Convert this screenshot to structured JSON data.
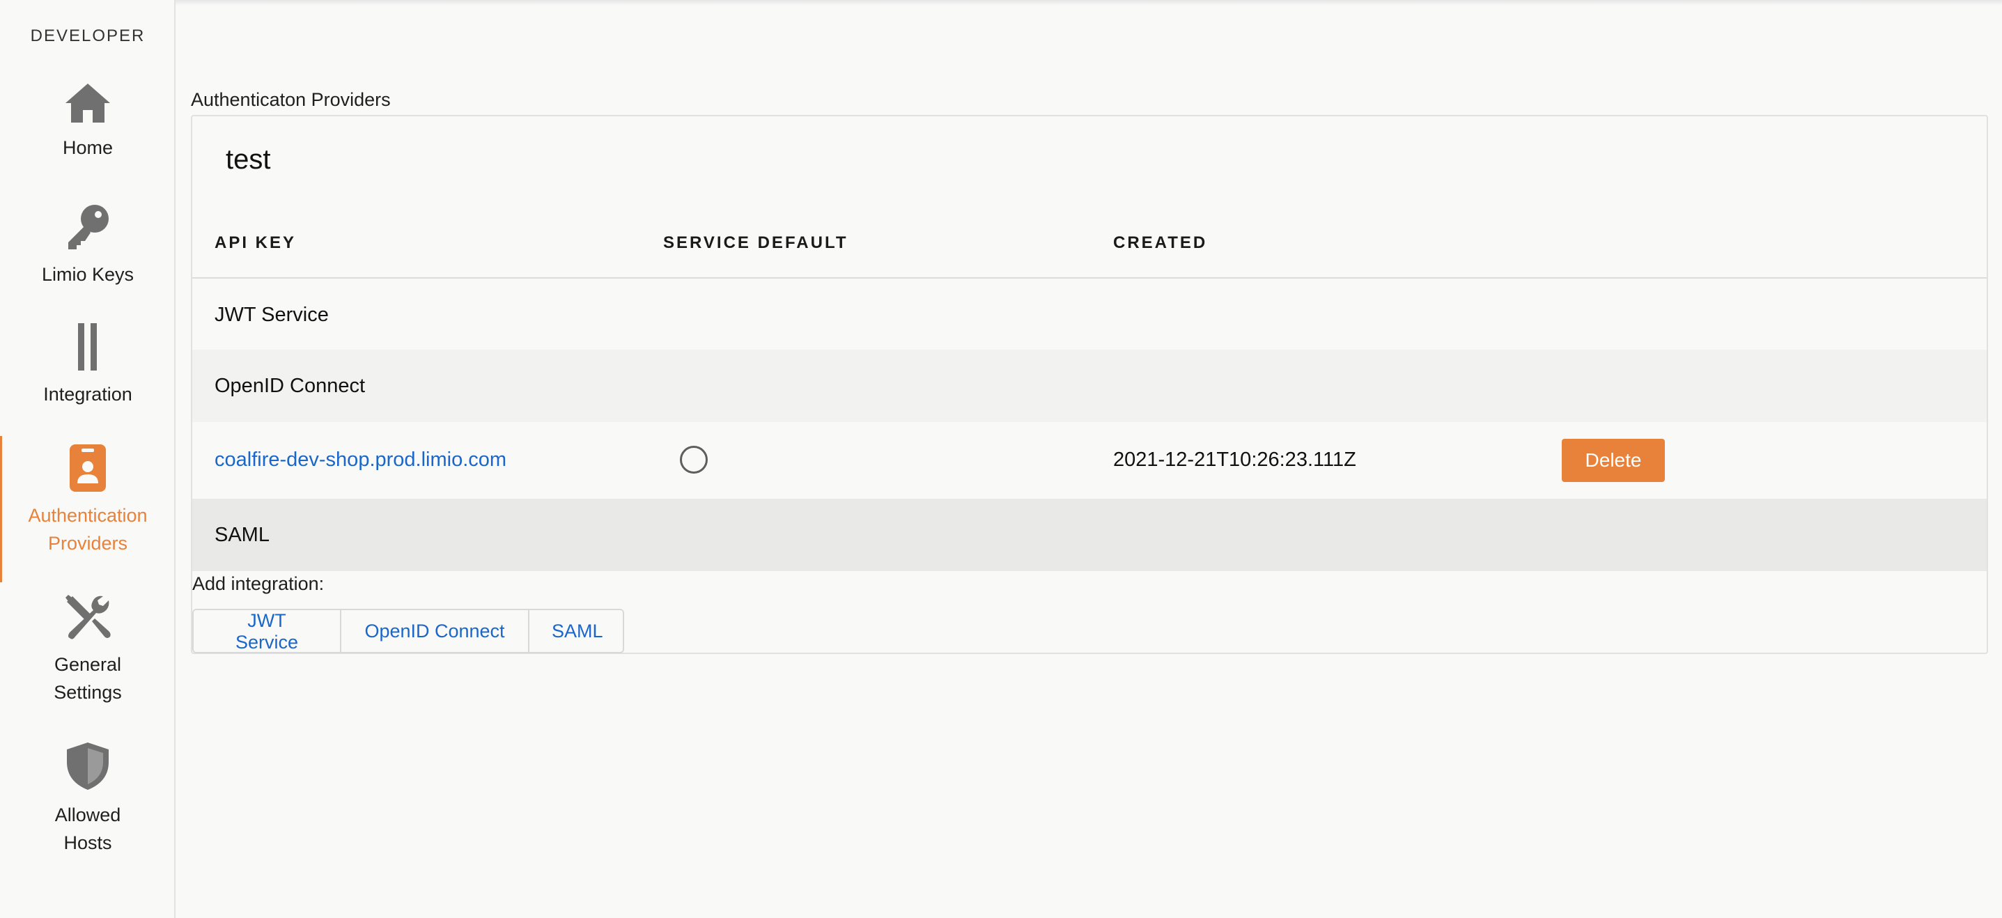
{
  "sidebar": {
    "heading": "DEVELOPER",
    "items": [
      {
        "label": "Home",
        "icon": "home-icon"
      },
      {
        "label": "Limio Keys",
        "icon": "key-icon"
      },
      {
        "label": "Integration",
        "icon": "integration-icon"
      },
      {
        "label": "Authentication Providers",
        "icon": "id-badge-icon",
        "active": true
      },
      {
        "label": "General Settings",
        "icon": "tools-icon"
      },
      {
        "label": "Allowed Hosts",
        "icon": "shield-icon"
      }
    ]
  },
  "main": {
    "section_title": "Authenticaton Providers",
    "card": {
      "title": "test",
      "columns": [
        "API KEY",
        "SERVICE DEFAULT",
        "CREATED"
      ],
      "groups": [
        "JWT Service",
        "OpenID Connect",
        "SAML"
      ],
      "row": {
        "api_key": "coalfire-dev-shop.prod.limio.com",
        "created": "2021-12-21T10:26:23.111Z",
        "delete_label": "Delete"
      },
      "add_integration_label": "Add integration:",
      "add_buttons": [
        "JWT Service",
        "OpenID Connect",
        "SAML"
      ]
    }
  },
  "colors": {
    "accent": "#e8823a",
    "link": "#1b66c9",
    "icon": "#707070"
  }
}
